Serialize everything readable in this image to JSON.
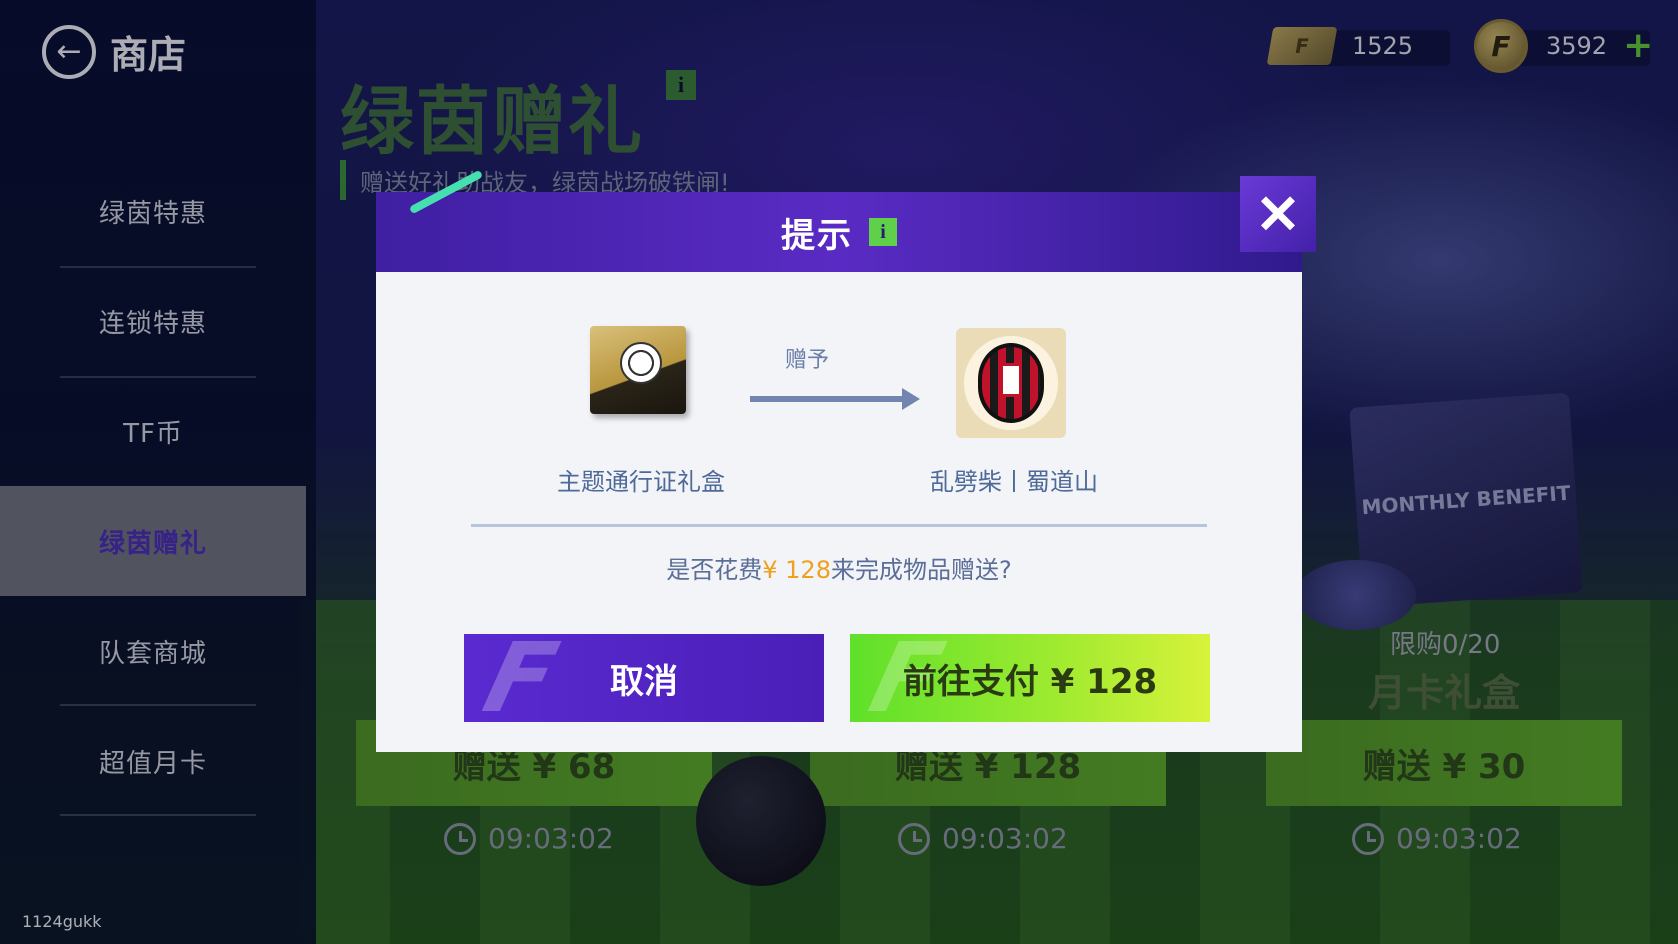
{
  "header": {
    "back_label": "商店",
    "page_title": "绿茵赠礼",
    "subtitle": "赠送好礼助战友，绿茵战场破铁闸!",
    "info_label": "i"
  },
  "currency": {
    "ticket_value": "1525",
    "coin_value": "3592",
    "ticket_symbol": "F",
    "coin_symbol": "F",
    "plus_label": "+"
  },
  "sidebar": {
    "items": [
      {
        "label": "绿茵特惠"
      },
      {
        "label": "连锁特惠"
      },
      {
        "label": "TF币"
      },
      {
        "label": "绿茵赠礼"
      },
      {
        "label": "队套商城"
      },
      {
        "label": "超值月卡"
      }
    ],
    "active_index": 3
  },
  "cards": [
    {
      "price_label": "赠送 ¥ 68",
      "timer": "09:03:02"
    },
    {
      "price_label": "赠送 ¥ 128",
      "timer": "09:03:02"
    },
    {
      "price_label": "赠送 ¥ 30",
      "timer": "09:03:02",
      "limit": "限购0/20",
      "name": "月卡礼盒",
      "box_text": "MONTHLY BENEFIT"
    }
  ],
  "modal": {
    "title": "提示",
    "info_label": "i",
    "close_label": "✕",
    "gift_label": "赠予",
    "item_from": "主题通行证礼盒",
    "item_to": "乱劈柴丨蜀道山",
    "question_prefix": "是否花费",
    "question_price": "¥ 128",
    "question_suffix": "来完成物品赠送?",
    "cancel_label": "取消",
    "pay_label": "前往支付 ¥ 128"
  },
  "watermark": "1124gukk",
  "colors": {
    "accent_purple": "#4a1fb8",
    "accent_green": "#5fe02a",
    "price_orange": "#f0a020"
  }
}
